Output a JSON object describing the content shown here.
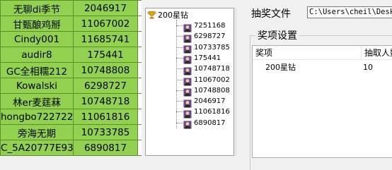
{
  "sheet": {
    "rows": [
      {
        "name": "无聊di季节",
        "id": "2046917"
      },
      {
        "name": "甘甄酿鸡掰",
        "id": "11067002"
      },
      {
        "name": "Cindy001",
        "id": "11685741"
      },
      {
        "name": "audir8",
        "id": "175441"
      },
      {
        "name": "GC全相糯212",
        "id": "10748808"
      },
      {
        "name": "Kowalski",
        "id": "6298727"
      },
      {
        "name": "林er麦莛菻",
        "id": "10748718"
      },
      {
        "name": "hongbo722722",
        "id": "11061816"
      },
      {
        "name": "旁海无期",
        "id": "10733785"
      },
      {
        "name": "C_5A20777E93",
        "id": "6890817"
      }
    ]
  },
  "tree": {
    "root_label": "200星钻",
    "nodes": [
      "7251168",
      "6298727",
      "10733785",
      "175441",
      "10748718",
      "11067002",
      "10748808",
      "2046917",
      "11061816",
      "6890817"
    ]
  },
  "settings": {
    "file_label": "抽奖文件",
    "file_path": "C:\\Users\\cheil\\Deskt",
    "group_label": "奖项设置",
    "columns": [
      "奖项",
      "抽取人数"
    ],
    "rows": [
      {
        "prize": "200星钻",
        "count": "10"
      }
    ]
  }
}
